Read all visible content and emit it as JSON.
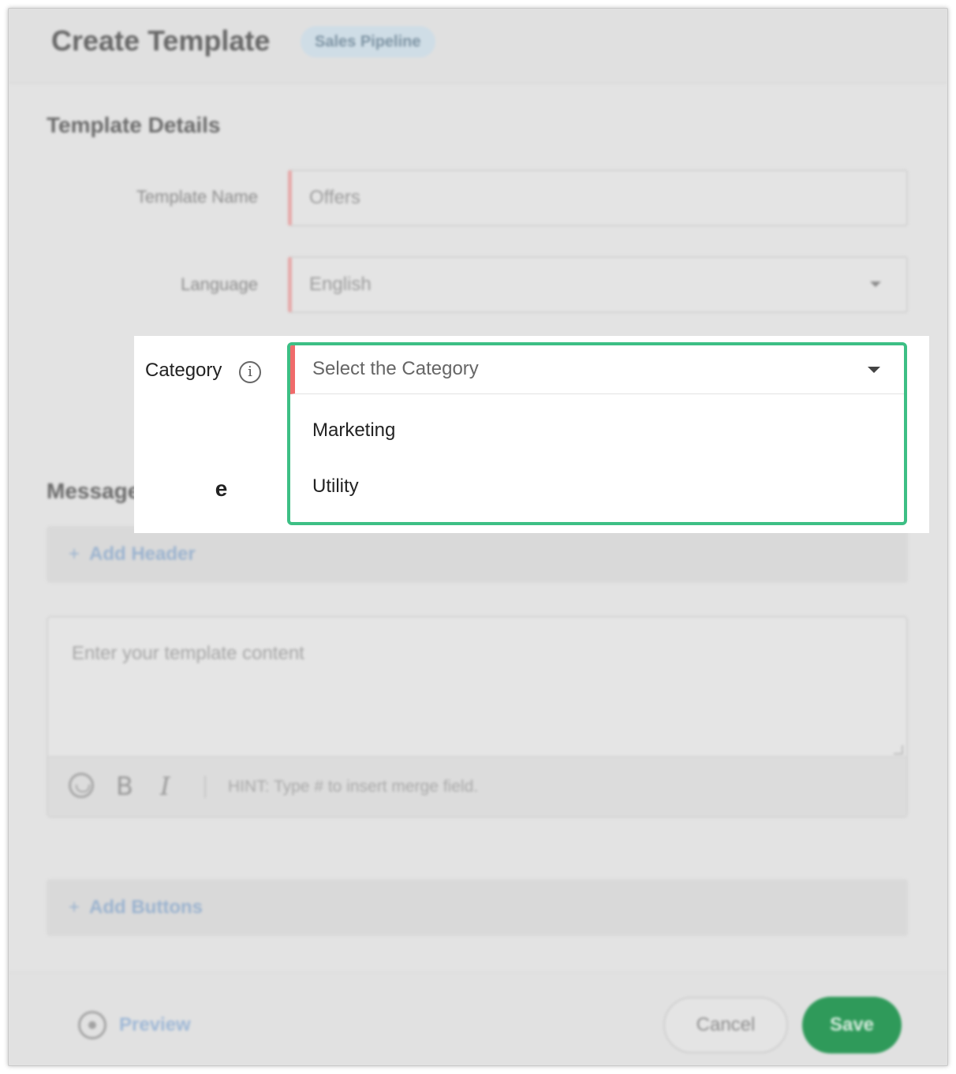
{
  "header": {
    "title": "Create Template",
    "badge": "Sales Pipeline"
  },
  "details": {
    "section_title": "Template Details",
    "template_name_label": "Template Name",
    "template_name_value": "Offers",
    "language_label": "Language",
    "language_value": "English",
    "category_label": "Category",
    "category_placeholder": "Select the Category",
    "category_options": [
      "Marketing",
      "Utility"
    ]
  },
  "message": {
    "section_title": "Message",
    "add_header": "Add Header",
    "content_placeholder": "Enter your template content",
    "hint": "HINT: Type # to insert merge field.",
    "add_buttons": "Add Buttons"
  },
  "footer": {
    "preview": "Preview",
    "cancel": "Cancel",
    "save": "Save"
  },
  "colors": {
    "focus_border": "#3dbf85",
    "required_marker": "#f06b6b",
    "save_button": "#2f9a5a"
  }
}
